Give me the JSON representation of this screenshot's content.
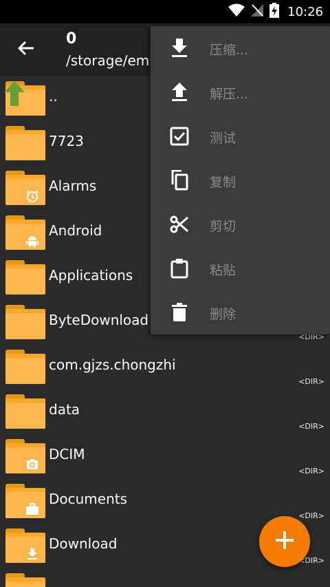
{
  "status": {
    "time": "10:26"
  },
  "toolbar": {
    "count": "0",
    "path": "/storage/emu"
  },
  "files": [
    {
      "name": "..",
      "dir_label": "",
      "badge": "up-arrow"
    },
    {
      "name": "7723",
      "dir_label": "",
      "badge": ""
    },
    {
      "name": "Alarms",
      "dir_label": "",
      "badge": "alarm-clock"
    },
    {
      "name": "Android",
      "dir_label": "",
      "badge": "android"
    },
    {
      "name": "Applications",
      "dir_label": "",
      "badge": ""
    },
    {
      "name": "ByteDownload",
      "dir_label": "<DIR>",
      "badge": ""
    },
    {
      "name": "com.gjzs.chongzhi",
      "dir_label": "<DIR>",
      "badge": ""
    },
    {
      "name": "data",
      "dir_label": "<DIR>",
      "badge": ""
    },
    {
      "name": "DCIM",
      "dir_label": "<DIR>",
      "badge": "camera"
    },
    {
      "name": "Documents",
      "dir_label": "<DIR>",
      "badge": "briefcase"
    },
    {
      "name": "Download",
      "dir_label": "<DIR>",
      "badge": "download"
    },
    {
      "name": "",
      "dir_label": "",
      "badge": ""
    }
  ],
  "menu": {
    "items": [
      {
        "label": "压缩...",
        "icon": "download-icon"
      },
      {
        "label": "解压...",
        "icon": "upload-icon"
      },
      {
        "label": "测试",
        "icon": "checkbox-icon"
      },
      {
        "label": "复制",
        "icon": "copy-icon"
      },
      {
        "label": "剪切",
        "icon": "scissors-icon"
      },
      {
        "label": "粘贴",
        "icon": "clipboard-icon"
      },
      {
        "label": "删除",
        "icon": "trash-icon"
      }
    ]
  },
  "colors": {
    "accent": "#f57c00",
    "folder": "#ffb74d",
    "menu_bg": "#3b3b3b",
    "disabled_text": "#8a8a8a"
  }
}
